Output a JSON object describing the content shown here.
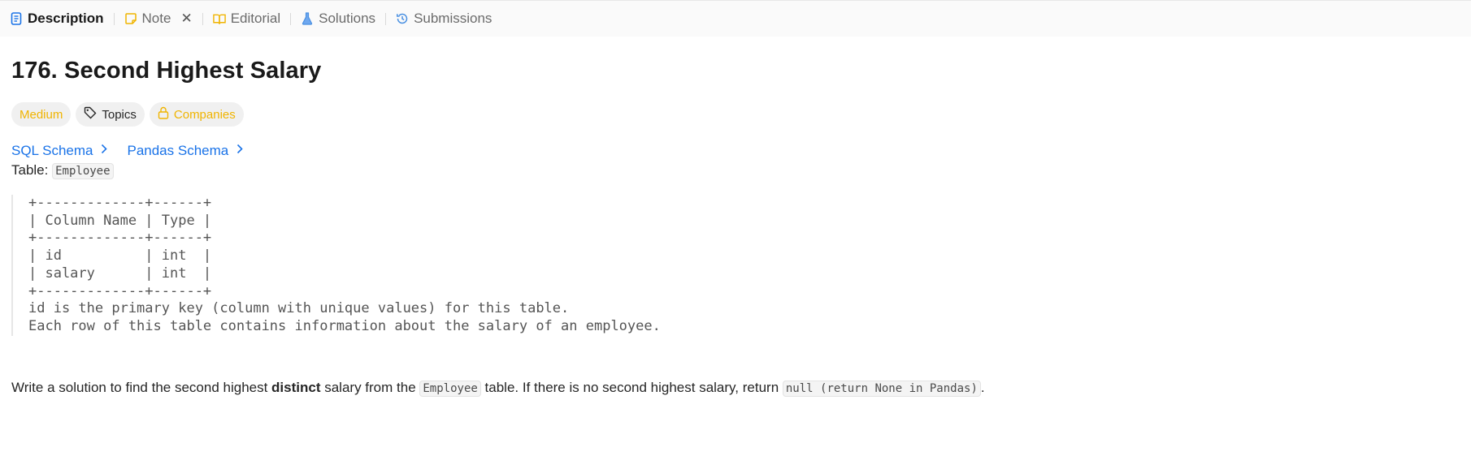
{
  "tabs": [
    {
      "label": "Description",
      "icon": "description-icon",
      "active": true
    },
    {
      "label": "Note",
      "icon": "note-icon"
    },
    {
      "label": "Editorial",
      "icon": "book-icon"
    },
    {
      "label": "Solutions",
      "icon": "flask-icon"
    },
    {
      "label": "Submissions",
      "icon": "history-icon"
    }
  ],
  "problem": {
    "title": "176. Second Highest Salary",
    "difficulty": "Medium",
    "topics_label": "Topics",
    "companies_label": "Companies"
  },
  "schemas": {
    "sql": "SQL Schema",
    "pandas": "Pandas Schema"
  },
  "table_intro": {
    "label": "Table:",
    "name": "Employee"
  },
  "schema_block": "+-------------+------+\n| Column Name | Type |\n+-------------+------+\n| id          | int  |\n| salary      | int  |\n+-------------+------+\nid is the primary key (column with unique values) for this table.\nEach row of this table contains information about the salary of an employee.",
  "description": {
    "part1": "Write a solution to find the second highest ",
    "bold": "distinct",
    "part2": " salary from the ",
    "table_code": "Employee",
    "part3": " table. If there is no second highest salary, return ",
    "null_code": "null (return None in Pandas)",
    "part4": "."
  },
  "colors": {
    "accent_blue": "#1a73e8",
    "medium_yellow": "#f0b400"
  }
}
